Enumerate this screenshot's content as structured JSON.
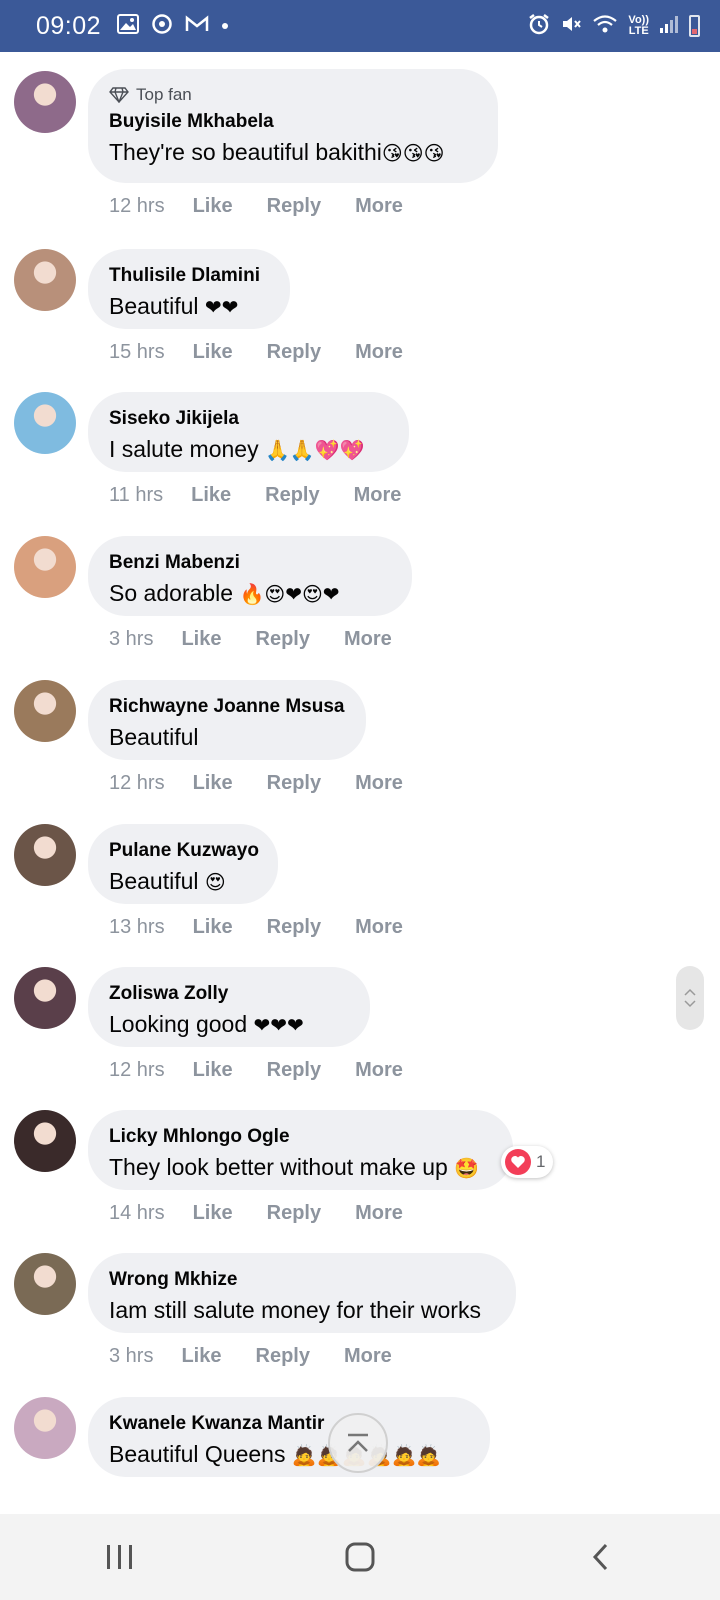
{
  "status_bar": {
    "time": "09:02",
    "lte_label_1": "Vo))",
    "lte_label_2": "LTE"
  },
  "comments": [
    {
      "badge": "Top fan",
      "author": "Buyisile Mkhabela",
      "text": "They're so beautiful bakithi",
      "emoji": "😘😘😘",
      "time": "12 hrs",
      "avatar_color": "#8e6a8a"
    },
    {
      "author": "Thulisile Dlamini",
      "text": "Beautiful ",
      "emoji": "❤❤",
      "time": "15 hrs",
      "avatar_color": "#b8907a"
    },
    {
      "author": "Siseko Jikijela",
      "text": "I salute money ",
      "emoji": "🙏🙏💖💖",
      "time": "11 hrs",
      "avatar_color": "#7fbbe0"
    },
    {
      "author": "Benzi Mabenzi",
      "text": "So adorable ",
      "emoji": "🔥😍❤😍❤",
      "time": "3 hrs",
      "avatar_color": "#d9a07e"
    },
    {
      "author": "Richwayne Joanne Msusa",
      "text": "Beautiful",
      "emoji": "",
      "time": "12 hrs",
      "avatar_color": "#9a7a5c"
    },
    {
      "author": "Pulane Kuzwayo",
      "text": "Beautiful ",
      "emoji": "😍",
      "time": "13 hrs",
      "avatar_color": "#6b5548"
    },
    {
      "author": "Zoliswa Zolly",
      "text": "Looking good ",
      "emoji": "❤❤❤",
      "time": "12 hrs",
      "avatar_color": "#5a3f4a"
    },
    {
      "author": "Licky Mhlongo Ogle",
      "text": "They look better without make up ",
      "emoji": "🤩",
      "time": "14 hrs",
      "avatar_color": "#3a2a2a",
      "reaction_count": "1"
    },
    {
      "author": "Wrong Mkhize",
      "text": "Iam still salute money for their works",
      "emoji": "",
      "time": "3 hrs",
      "avatar_color": "#7a6a55"
    },
    {
      "author": "Kwanele Kwanza Mantir",
      "text": "Beautiful Queens ",
      "emoji": "🙇🙇🙇🙇🙇🙇",
      "time": "",
      "avatar_color": "#c9a9c0"
    }
  ],
  "actions": {
    "like": "Like",
    "reply": "Reply",
    "more": "More"
  },
  "colors": {
    "status_bar": "#3b5998",
    "bubble": "#eff0f3",
    "meta_text": "#8d949e",
    "heart": "#f33e58"
  }
}
